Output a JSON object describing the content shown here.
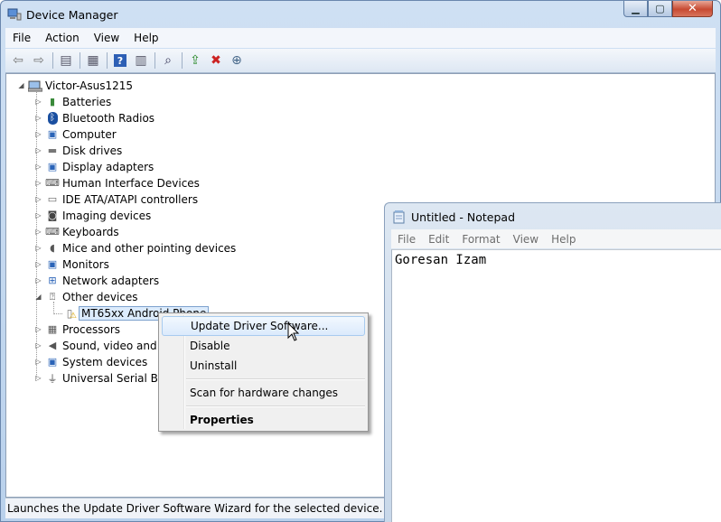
{
  "device_manager": {
    "title": "Device Manager",
    "menu": [
      "File",
      "Action",
      "View",
      "Help"
    ],
    "root": "Victor-Asus1215",
    "categories": [
      {
        "label": "Batteries",
        "icon": "battery-icon"
      },
      {
        "label": "Bluetooth Radios",
        "icon": "bluetooth-icon"
      },
      {
        "label": "Computer",
        "icon": "computer-icon"
      },
      {
        "label": "Disk drives",
        "icon": "disk-drive-icon"
      },
      {
        "label": "Display adapters",
        "icon": "display-adapter-icon"
      },
      {
        "label": "Human Interface Devices",
        "icon": "hid-icon"
      },
      {
        "label": "IDE ATA/ATAPI controllers",
        "icon": "ide-controller-icon"
      },
      {
        "label": "Imaging devices",
        "icon": "camera-icon"
      },
      {
        "label": "Keyboards",
        "icon": "keyboard-icon"
      },
      {
        "label": "Mice and other pointing devices",
        "icon": "mouse-icon"
      },
      {
        "label": "Monitors",
        "icon": "monitor-icon"
      },
      {
        "label": "Network adapters",
        "icon": "network-adapter-icon"
      },
      {
        "label": "Other devices",
        "icon": "unknown-device-icon"
      },
      {
        "label": "Processors",
        "icon": "processor-icon"
      },
      {
        "label": "Sound, video and ga",
        "icon": "speaker-icon"
      },
      {
        "label": "System devices",
        "icon": "system-devices-icon"
      },
      {
        "label": "Universal Serial Bus",
        "icon": "usb-icon"
      }
    ],
    "selected_device": "MT65xx Android Phone",
    "status_text": "Launches the Update Driver Software Wizard for the selected device."
  },
  "context_menu": {
    "items": [
      "Update Driver Software...",
      "Disable",
      "Uninstall",
      "Scan for hardware changes",
      "Properties"
    ]
  },
  "notepad": {
    "title": "Untitled - Notepad",
    "menu": [
      "File",
      "Edit",
      "Format",
      "View",
      "Help"
    ],
    "content": "Goresan Izam"
  }
}
